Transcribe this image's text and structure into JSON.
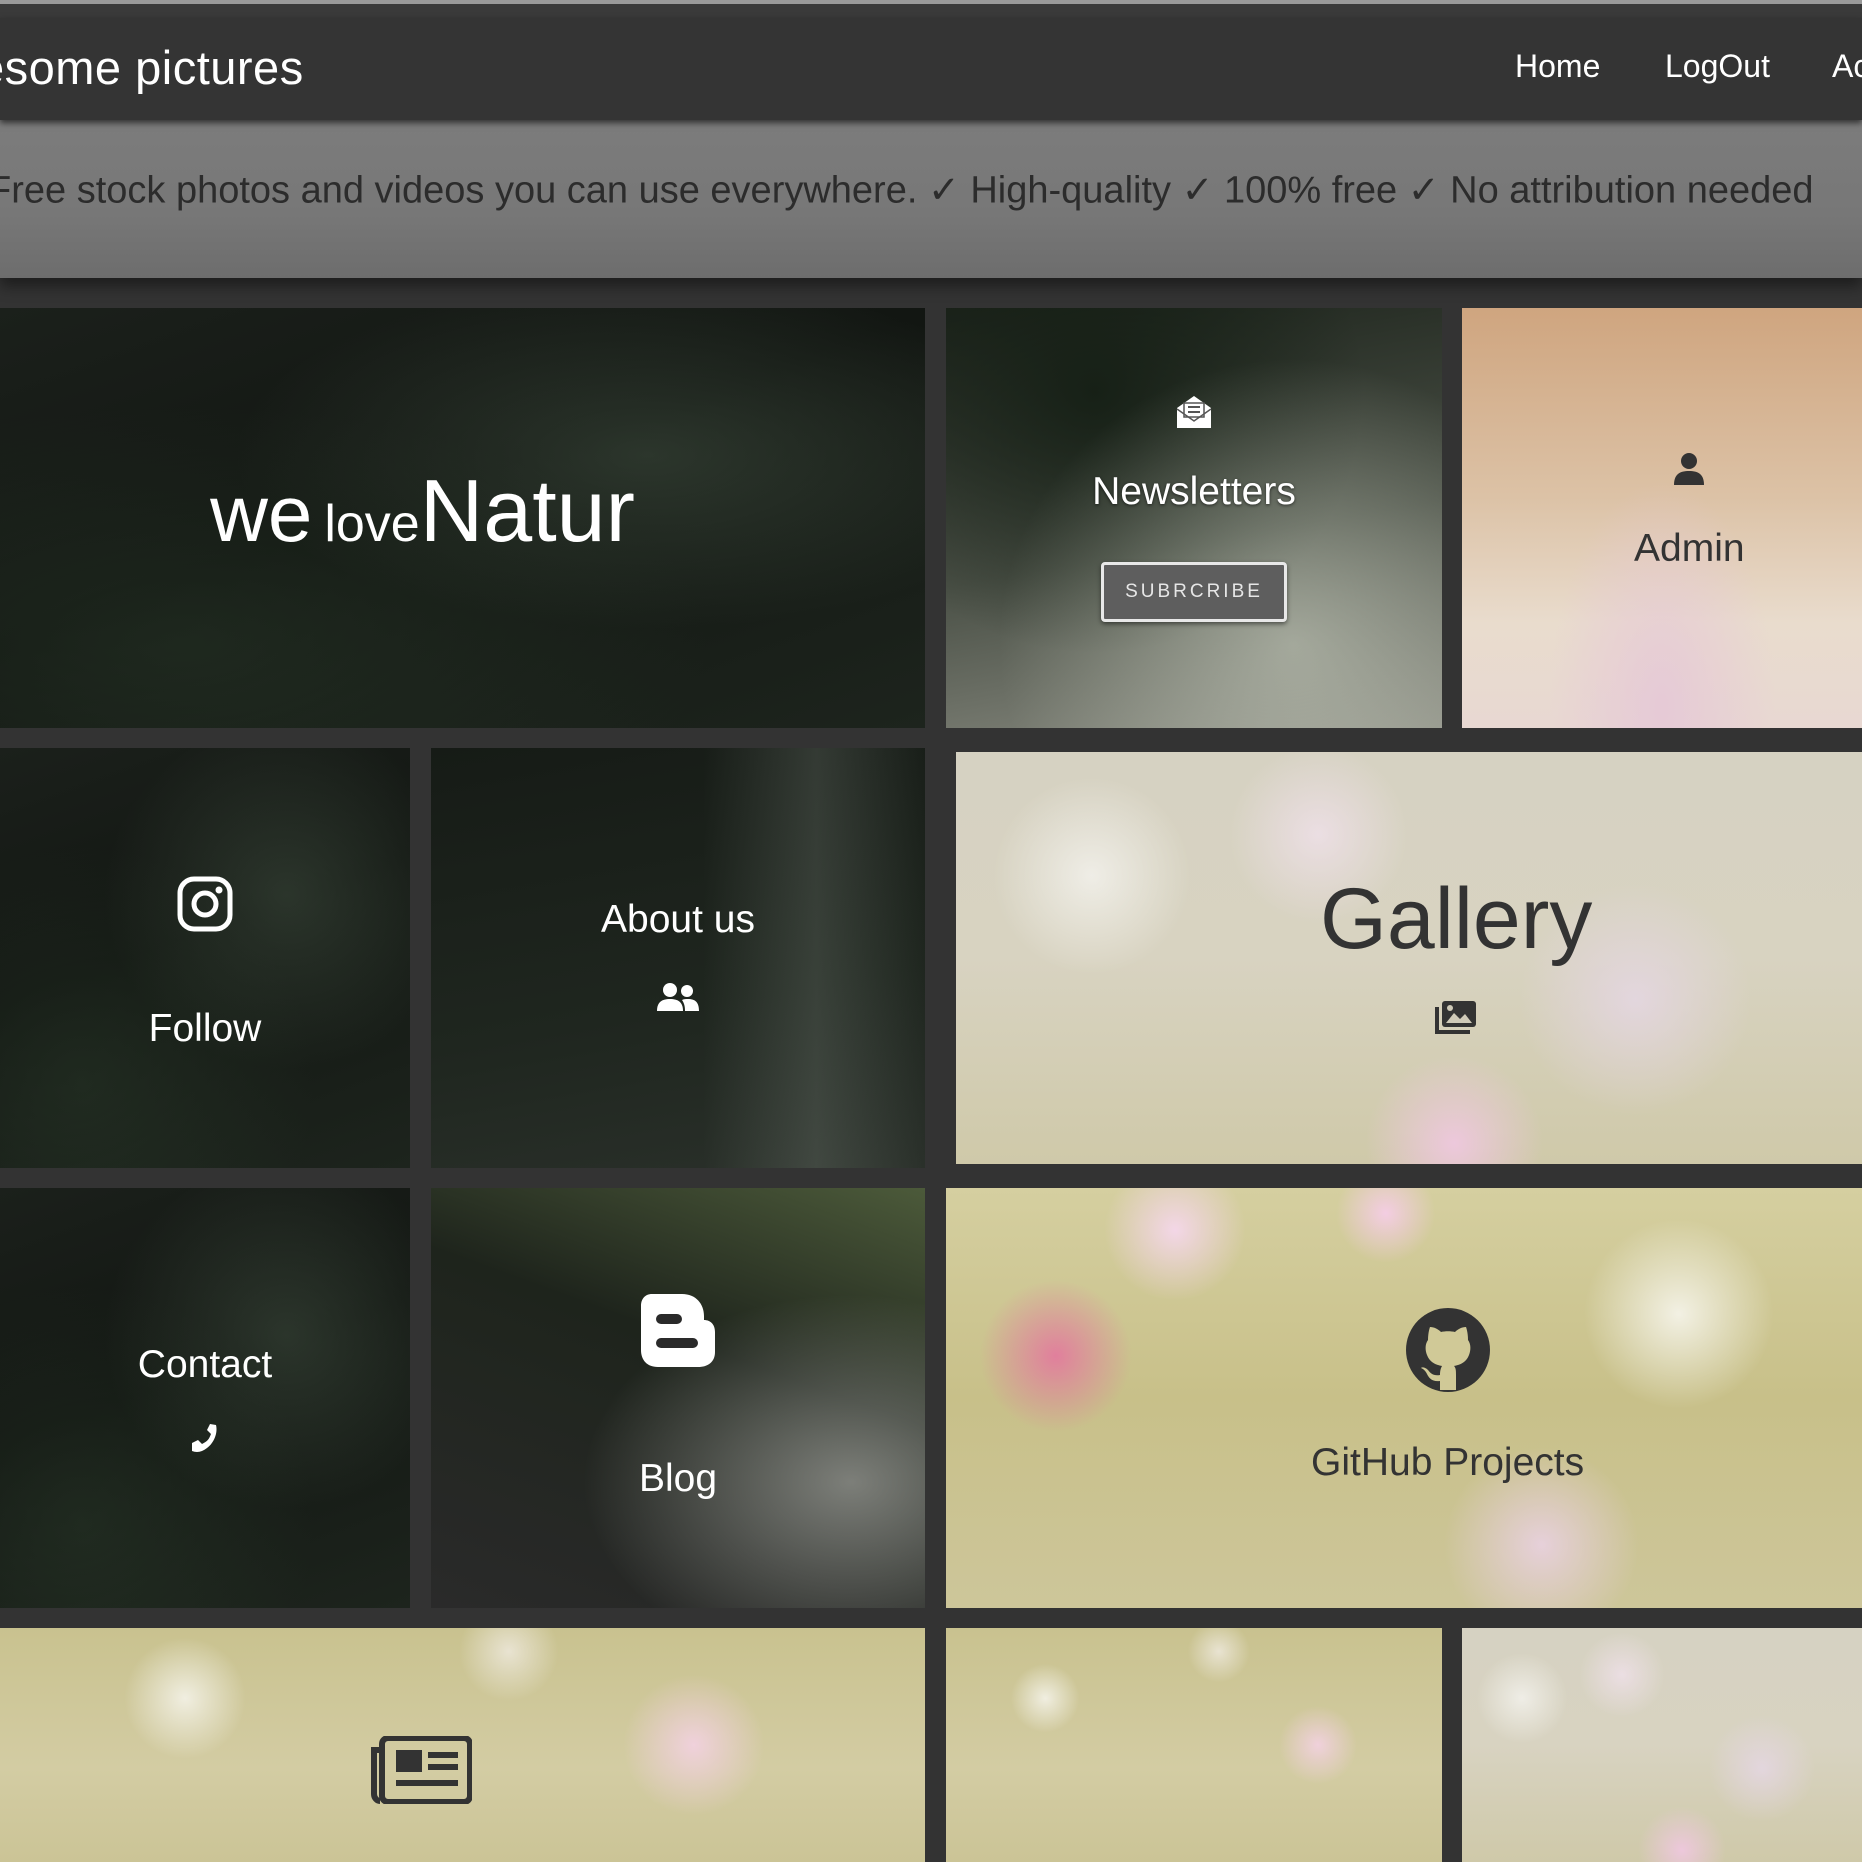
{
  "navbar": {
    "brand": "esome pictures",
    "links": [
      "Home",
      "LogOut",
      "Ac"
    ]
  },
  "banner": {
    "text": "Free stock photos and videos you can use everywhere. ✓ High-quality ✓ 100% free ✓ No attribution needed"
  },
  "tiles": {
    "hero": {
      "word1": "we",
      "word2": "love",
      "word3": "Natur"
    },
    "newsletters": {
      "label": "Newsletters",
      "button": "SUBRCRIBE",
      "icon": "envelope-open-text-icon"
    },
    "admin": {
      "label": "Admin",
      "icon": "user-icon"
    },
    "follow": {
      "label": "Follow",
      "icon": "instagram-icon"
    },
    "about": {
      "label": "About us",
      "icon": "users-icon"
    },
    "gallery": {
      "label": "Gallery",
      "icon": "images-icon"
    },
    "contact": {
      "label": "Contact",
      "icon": "phone-icon"
    },
    "blog": {
      "label": "Blog",
      "icon": "blogger-icon"
    },
    "github": {
      "label": "GitHub Projects",
      "icon": "github-icon"
    },
    "news": {
      "icon": "newspaper-icon"
    }
  },
  "colors": {
    "navbar_bg": "#343434",
    "banner_bg": "#777777",
    "page_bg": "#333333",
    "dark_text": "#333333"
  }
}
